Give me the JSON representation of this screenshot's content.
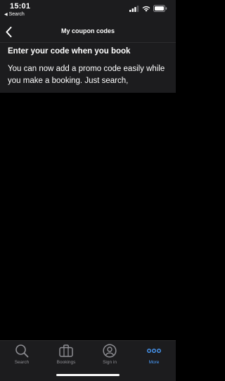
{
  "status_bar": {
    "time": "15:01",
    "back_app_label": "Search"
  },
  "nav": {
    "title": "My coupon codes"
  },
  "banner": {
    "title": "Enter your code when you book",
    "body": "You can now add a promo code easily while you make a booking. Just search,"
  },
  "tabs": [
    {
      "label": "Search",
      "icon": "search-icon",
      "active": false
    },
    {
      "label": "Bookings",
      "icon": "briefcase-icon",
      "active": false
    },
    {
      "label": "Sign in",
      "icon": "user-icon",
      "active": false
    },
    {
      "label": "More",
      "icon": "more-dots-icon",
      "active": true
    }
  ],
  "colors": {
    "background": "#000000",
    "bar": "#1c1c1e",
    "accent": "#4a9eff",
    "inactive": "#8e8e93"
  }
}
